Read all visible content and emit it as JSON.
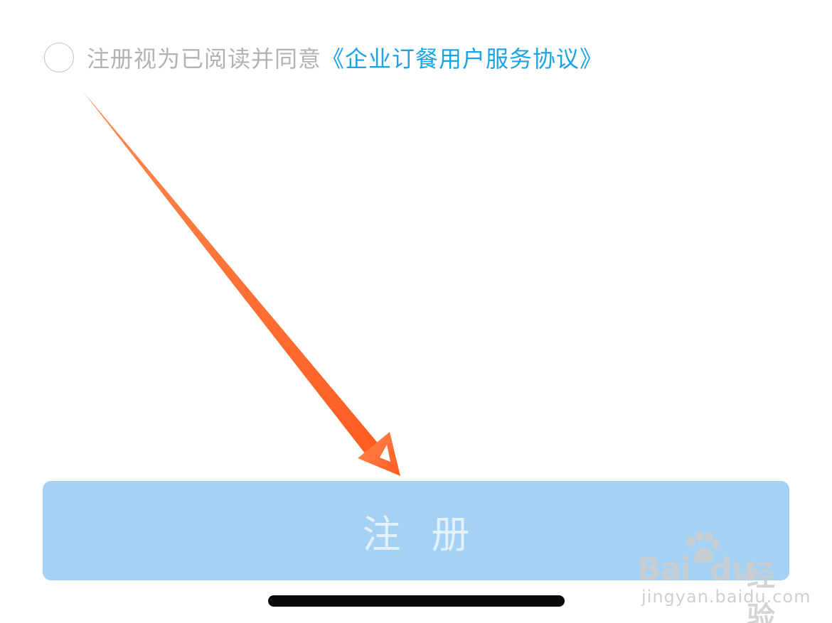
{
  "agreement": {
    "checked": false,
    "prefix_text": "注册视为已阅读并同意",
    "link_text": "《企业订餐用户服务协议》"
  },
  "register_button": {
    "label": "注 册",
    "enabled": false
  },
  "annotation": {
    "arrow_icon": "orange-arrow-icon",
    "color": "#ff6a2b"
  },
  "watermark": {
    "brand_bai": "Bai",
    "brand_du": "du",
    "brand_jingyan": "经验",
    "url": "jingyan.baidu.com"
  },
  "colors": {
    "link": "#1aa3e8",
    "muted_text": "#b3b3b3",
    "button_bg_disabled": "#a3d2f5",
    "button_text_disabled": "#e3f1fc",
    "arrow": "#ff6a2b"
  }
}
